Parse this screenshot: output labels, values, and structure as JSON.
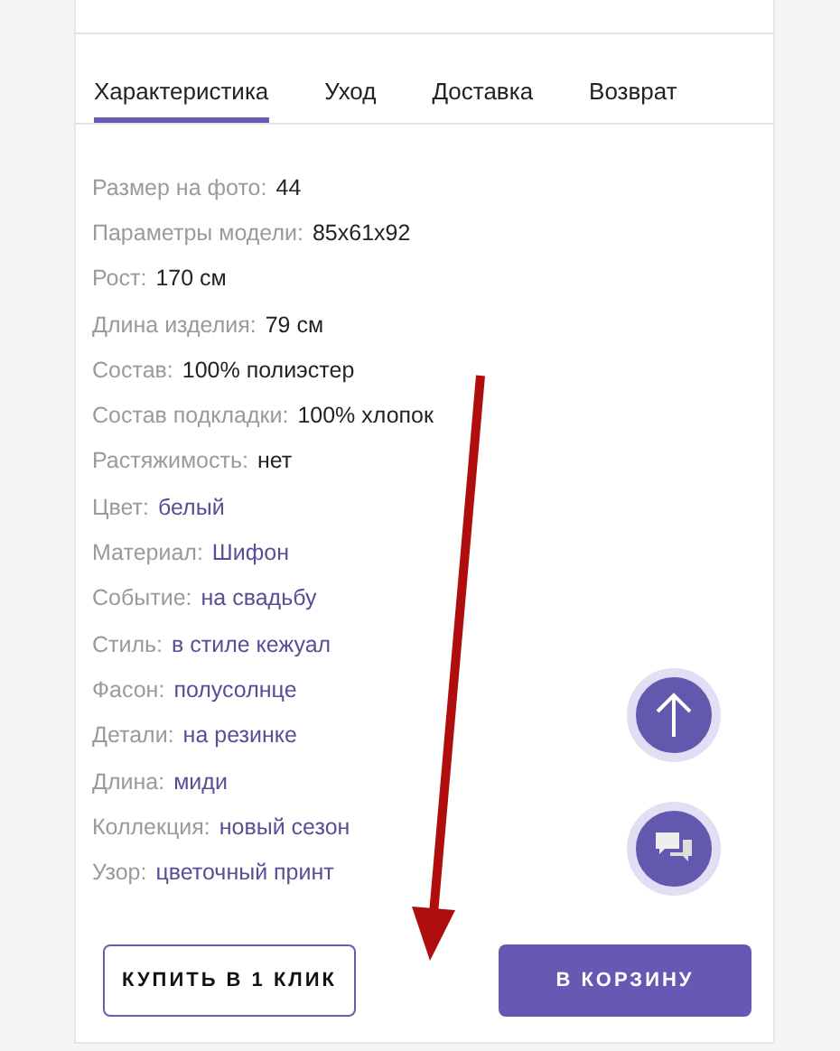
{
  "tabs": [
    {
      "label": "Характеристика",
      "selected": true
    },
    {
      "label": "Уход",
      "selected": false
    },
    {
      "label": "Доставка",
      "selected": false
    },
    {
      "label": "Возврат",
      "selected": false
    }
  ],
  "specs": [
    {
      "label": "Размер на фото:",
      "value": "44",
      "kind": "text"
    },
    {
      "label": "Параметры модели:",
      "value": "85x61x92",
      "kind": "text"
    },
    {
      "label": "Рост:",
      "value": "170 см",
      "kind": "text"
    },
    {
      "label": "Длина изделия:",
      "value": "79 см",
      "kind": "text"
    },
    {
      "label": "Состав:",
      "value": "100% полиэстер",
      "kind": "text"
    },
    {
      "label": "Состав подкладки:",
      "value": "100% хлопок",
      "kind": "text"
    },
    {
      "label": "Растяжимость:",
      "value": "нет",
      "kind": "text"
    },
    {
      "label": "Цвет:",
      "value": "белый",
      "kind": "link"
    },
    {
      "label": "Материал:",
      "value": "Шифон",
      "kind": "link"
    },
    {
      "label": "Событие:",
      "value": "на свадьбу",
      "kind": "link"
    },
    {
      "label": "Стиль:",
      "value": "в стиле кежуал",
      "kind": "link"
    },
    {
      "label": "Фасон:",
      "value": "полусолнце",
      "kind": "link"
    },
    {
      "label": "Детали:",
      "value": "на резинке",
      "kind": "link"
    },
    {
      "label": "Длина:",
      "value": "миди",
      "kind": "link"
    },
    {
      "label": "Коллекция:",
      "value": "новый сезон",
      "kind": "link"
    },
    {
      "label": "Узор:",
      "value": "цветочный принт",
      "kind": "link"
    }
  ],
  "buttons": {
    "buy_one_click": "КУПИТЬ В 1 КЛИК",
    "add_to_cart": "В КОРЗИНУ"
  }
}
